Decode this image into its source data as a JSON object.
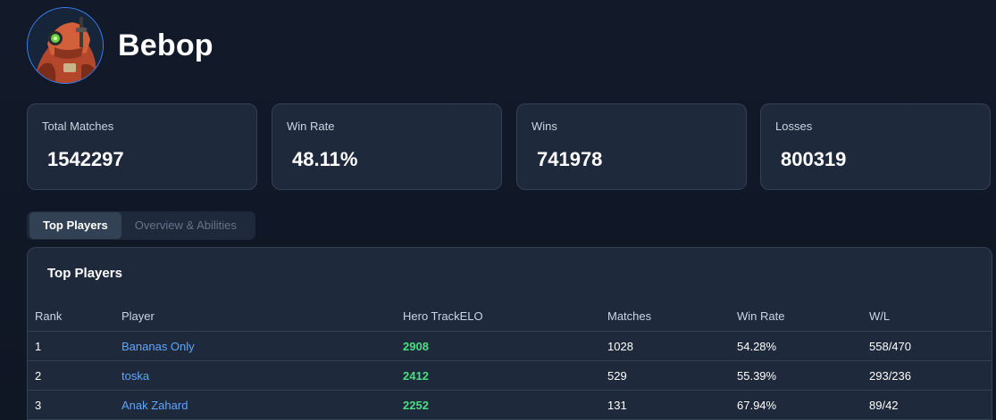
{
  "hero": {
    "name": "Bebop",
    "avatar_icon": "bebop-robot-portrait"
  },
  "stats": [
    {
      "label": "Total Matches",
      "value": "1542297"
    },
    {
      "label": "Win Rate",
      "value": "48.11%"
    },
    {
      "label": "Wins",
      "value": "741978"
    },
    {
      "label": "Losses",
      "value": "800319"
    }
  ],
  "tabs": [
    {
      "label": "Top Players",
      "active": true
    },
    {
      "label": "Overview & Abilities",
      "active": false
    }
  ],
  "top_players": {
    "title": "Top Players",
    "columns": [
      "Rank",
      "Player",
      "Hero TrackELO",
      "Matches",
      "Win Rate",
      "W/L"
    ],
    "rows": [
      {
        "rank": "1",
        "player": "Bananas Only",
        "elo": "2908",
        "matches": "1028",
        "win_rate": "54.28%",
        "wl": "558/470"
      },
      {
        "rank": "2",
        "player": "toska",
        "elo": "2412",
        "matches": "529",
        "win_rate": "55.39%",
        "wl": "293/236"
      },
      {
        "rank": "3",
        "player": "Anak Zahard",
        "elo": "2252",
        "matches": "131",
        "win_rate": "67.94%",
        "wl": "89/42"
      }
    ]
  },
  "colors": {
    "background": "#111827",
    "card": "#1e293b",
    "border": "#334155",
    "link": "#60a5fa",
    "elo": "#4ade80"
  }
}
